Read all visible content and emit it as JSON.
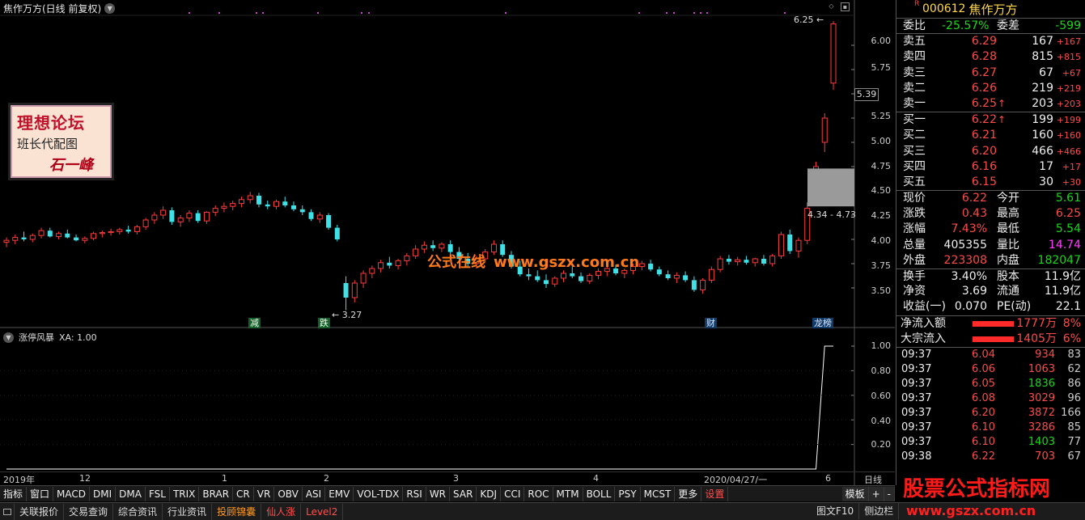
{
  "chart": {
    "title": "焦作万方(日线 前复权)",
    "high_label": "6.25",
    "low_label": "3.27",
    "range_label": "4.34 - 4.73",
    "current_price_box": "5.39",
    "price_ticks": [
      "6.00",
      "5.75",
      "5.50",
      "5.25",
      "5.00",
      "4.75",
      "4.50",
      "4.25",
      "4.00",
      "3.75",
      "3.50"
    ],
    "events": [
      {
        "label": "减",
        "style": "green"
      },
      {
        "label": "跌",
        "style": "green"
      },
      {
        "label": "财",
        "style": "blue"
      },
      {
        "label": "龙榜",
        "style": "blue"
      }
    ],
    "watermark_box": {
      "line1": "理想论坛",
      "line2": "班长代配图",
      "line3": "石一峰"
    },
    "site_watermark": {
      "text": "公式在线",
      "url": "www.gszx.com.cn"
    }
  },
  "indicator": {
    "name": "涨停风暴",
    "param": "XA: 1.00",
    "ticks": [
      "1.00",
      "0.80",
      "0.60",
      "0.40",
      "0.20"
    ]
  },
  "date_axis": [
    "2019年",
    "12",
    "1",
    "2",
    "3",
    "4",
    "2020/04/27/一",
    "6",
    "日线"
  ],
  "indicator_tabs": [
    "指标",
    "窗口",
    "MACD",
    "DMI",
    "DMA",
    "FSL",
    "TRIX",
    "BRAR",
    "CR",
    "VR",
    "OBV",
    "ASI",
    "EMV",
    "VOL-TDX",
    "RSI",
    "WR",
    "SAR",
    "KDJ",
    "CCI",
    "ROC",
    "MTM",
    "BOLL",
    "PSY",
    "MCST",
    "更多",
    "设置"
  ],
  "tab_right": [
    "模板",
    "+",
    "-"
  ],
  "status_buttons": [
    {
      "label": "关联报价",
      "style": "normal"
    },
    {
      "label": "交易查询",
      "style": "normal"
    },
    {
      "label": "综合资讯",
      "style": "normal"
    },
    {
      "label": "行业资讯",
      "style": "normal"
    },
    {
      "label": "投顾锦囊",
      "style": "orange"
    },
    {
      "label": "仙人涨",
      "style": "red"
    },
    {
      "label": "Level2",
      "style": "red"
    }
  ],
  "status_right": [
    "图文F10",
    "侧边栏"
  ],
  "quote": {
    "badge": "R",
    "code": "000612",
    "name": "焦作万方",
    "weibi_label": "委比",
    "weibi": "-25.57%",
    "weicha_label": "委差",
    "weicha": "-599",
    "sell": [
      {
        "label": "卖五",
        "price": "6.29",
        "vol": "167",
        "chg": "+167",
        "arrow": ""
      },
      {
        "label": "卖四",
        "price": "6.28",
        "vol": "815",
        "chg": "+815",
        "arrow": ""
      },
      {
        "label": "卖三",
        "price": "6.27",
        "vol": "67",
        "chg": "+67",
        "arrow": ""
      },
      {
        "label": "卖二",
        "price": "6.26",
        "vol": "219",
        "chg": "+219",
        "arrow": ""
      },
      {
        "label": "卖一",
        "price": "6.25",
        "vol": "203",
        "chg": "+203",
        "arrow": "↑"
      }
    ],
    "buy": [
      {
        "label": "买一",
        "price": "6.22",
        "vol": "199",
        "chg": "+199",
        "arrow": "↑"
      },
      {
        "label": "买二",
        "price": "6.21",
        "vol": "160",
        "chg": "+160",
        "arrow": ""
      },
      {
        "label": "买三",
        "price": "6.20",
        "vol": "466",
        "chg": "+466",
        "arrow": ""
      },
      {
        "label": "买四",
        "price": "6.16",
        "vol": "17",
        "chg": "+17",
        "arrow": ""
      },
      {
        "label": "买五",
        "price": "6.15",
        "vol": "30",
        "chg": "+30",
        "arrow": ""
      }
    ],
    "stats": [
      {
        "l1": "现价",
        "v1": "6.22",
        "c1": "red",
        "l2": "今开",
        "v2": "5.61",
        "c2": "green"
      },
      {
        "l1": "涨跌",
        "v1": "0.43",
        "c1": "red",
        "l2": "最高",
        "v2": "6.25",
        "c2": "red"
      },
      {
        "l1": "涨幅",
        "v1": "7.43%",
        "c1": "red",
        "l2": "最低",
        "v2": "5.54",
        "c2": "green"
      },
      {
        "l1": "总量",
        "v1": "405355",
        "c1": "white",
        "l2": "量比",
        "v2": "14.74",
        "c2": "magenta"
      },
      {
        "l1": "外盘",
        "v1": "223308",
        "c1": "red",
        "l2": "内盘",
        "v2": "182047",
        "c2": "green"
      },
      {
        "l1": "换手",
        "v1": "3.40%",
        "c1": "white",
        "l2": "股本",
        "v2": "11.9亿",
        "c2": "white"
      },
      {
        "l1": "净资",
        "v1": "3.69",
        "c1": "white",
        "l2": "流通",
        "v2": "11.9亿",
        "c2": "white"
      },
      {
        "l1": "收益(一)",
        "v1": "0.070",
        "c1": "white",
        "l2": "PE(动)",
        "v2": "22.1",
        "c2": "white"
      }
    ],
    "flows": [
      {
        "label": "净流入额",
        "value": "1777万",
        "pct": "8%",
        "bar_pct": 0.85
      },
      {
        "label": "大宗流入",
        "value": "1405万",
        "pct": "6%",
        "bar_pct": 0.85
      }
    ],
    "ticks": [
      {
        "time": "09:37",
        "price": "6.04",
        "vol": "934",
        "vcolor": "red",
        "cnt": "83"
      },
      {
        "time": "09:37",
        "price": "6.06",
        "vol": "1063",
        "vcolor": "red",
        "cnt": "62"
      },
      {
        "time": "09:37",
        "price": "6.05",
        "vol": "1836",
        "vcolor": "green",
        "cnt": "86"
      },
      {
        "time": "09:37",
        "price": "6.08",
        "vol": "3029",
        "vcolor": "red",
        "cnt": "96"
      },
      {
        "time": "09:37",
        "price": "6.20",
        "vol": "3872",
        "vcolor": "red",
        "cnt": "166"
      },
      {
        "time": "09:37",
        "price": "6.10",
        "vol": "3286",
        "vcolor": "red",
        "cnt": "85"
      },
      {
        "time": "09:37",
        "price": "6.10",
        "vol": "1403",
        "vcolor": "green",
        "cnt": "77"
      },
      {
        "time": "09:38",
        "price": "6.22",
        "vol": "703",
        "vcolor": "red",
        "cnt": "67"
      }
    ],
    "footer_text": "股票公式指标网",
    "footer_url": "www.gszx.com.cn"
  },
  "chart_data": {
    "type": "candlestick",
    "ylim": [
      3.3,
      6.3
    ],
    "indicator_series": {
      "name": "XA",
      "ylim": [
        0,
        1.05
      ]
    },
    "ohlc": [
      [
        3.97,
        4.02,
        3.92,
        3.99
      ],
      [
        3.99,
        4.05,
        3.95,
        4.02
      ],
      [
        4.02,
        4.08,
        3.98,
        4.0
      ],
      [
        4.0,
        4.06,
        3.97,
        4.04
      ],
      [
        4.04,
        4.12,
        4.01,
        4.09
      ],
      [
        4.09,
        4.12,
        4.02,
        4.03
      ],
      [
        4.03,
        4.08,
        4.0,
        4.06
      ],
      [
        4.06,
        4.1,
        4.01,
        4.02
      ],
      [
        4.02,
        4.05,
        3.98,
        3.99
      ],
      [
        3.99,
        4.03,
        3.96,
        4.01
      ],
      [
        4.01,
        4.08,
        3.99,
        4.06
      ],
      [
        4.06,
        4.09,
        4.02,
        4.07
      ],
      [
        4.07,
        4.11,
        4.04,
        4.08
      ],
      [
        4.08,
        4.12,
        4.05,
        4.1
      ],
      [
        4.1,
        4.14,
        4.06,
        4.08
      ],
      [
        4.08,
        4.15,
        4.05,
        4.13
      ],
      [
        4.13,
        4.22,
        4.1,
        4.2
      ],
      [
        4.2,
        4.28,
        4.16,
        4.25
      ],
      [
        4.25,
        4.34,
        4.21,
        4.3
      ],
      [
        4.3,
        4.33,
        4.15,
        4.18
      ],
      [
        4.18,
        4.25,
        4.13,
        4.22
      ],
      [
        4.22,
        4.3,
        4.18,
        4.27
      ],
      [
        4.27,
        4.3,
        4.17,
        4.19
      ],
      [
        4.19,
        4.29,
        4.16,
        4.28
      ],
      [
        4.28,
        4.35,
        4.24,
        4.32
      ],
      [
        4.32,
        4.38,
        4.28,
        4.34
      ],
      [
        4.34,
        4.4,
        4.3,
        4.37
      ],
      [
        4.37,
        4.44,
        4.33,
        4.41
      ],
      [
        4.41,
        4.49,
        4.37,
        4.45
      ],
      [
        4.45,
        4.48,
        4.33,
        4.36
      ],
      [
        4.36,
        4.4,
        4.31,
        4.34
      ],
      [
        4.34,
        4.41,
        4.31,
        4.39
      ],
      [
        4.39,
        4.44,
        4.33,
        4.35
      ],
      [
        4.35,
        4.39,
        4.29,
        4.31
      ],
      [
        4.31,
        4.35,
        4.25,
        4.28
      ],
      [
        4.28,
        4.31,
        4.19,
        4.21
      ],
      [
        4.21,
        4.28,
        4.17,
        4.25
      ],
      [
        4.25,
        4.27,
        4.1,
        4.12
      ],
      [
        4.12,
        4.15,
        3.98,
        4.0
      ],
      [
        3.55,
        3.62,
        3.27,
        3.4
      ],
      [
        3.4,
        3.58,
        3.35,
        3.55
      ],
      [
        3.55,
        3.68,
        3.5,
        3.65
      ],
      [
        3.65,
        3.73,
        3.6,
        3.7
      ],
      [
        3.7,
        3.79,
        3.66,
        3.76
      ],
      [
        3.76,
        3.82,
        3.7,
        3.73
      ],
      [
        3.73,
        3.8,
        3.69,
        3.78
      ],
      [
        3.78,
        3.86,
        3.73,
        3.83
      ],
      [
        3.83,
        3.94,
        3.8,
        3.9
      ],
      [
        3.9,
        3.98,
        3.86,
        3.94
      ],
      [
        3.94,
        3.99,
        3.88,
        3.91
      ],
      [
        3.91,
        3.97,
        3.87,
        3.95
      ],
      [
        3.95,
        3.99,
        3.85,
        3.87
      ],
      [
        3.87,
        3.92,
        3.78,
        3.8
      ],
      [
        3.8,
        3.86,
        3.72,
        3.75
      ],
      [
        3.75,
        3.83,
        3.7,
        3.8
      ],
      [
        3.8,
        3.9,
        3.76,
        3.87
      ],
      [
        3.87,
        3.99,
        3.84,
        3.95
      ],
      [
        3.95,
        3.99,
        3.82,
        3.84
      ],
      [
        3.84,
        3.88,
        3.7,
        3.72
      ],
      [
        3.72,
        3.78,
        3.62,
        3.64
      ],
      [
        3.64,
        3.7,
        3.58,
        3.62
      ],
      [
        3.62,
        3.68,
        3.56,
        3.58
      ],
      [
        3.58,
        3.64,
        3.5,
        3.54
      ],
      [
        3.54,
        3.62,
        3.51,
        3.6
      ],
      [
        3.6,
        3.68,
        3.56,
        3.65
      ],
      [
        3.65,
        3.72,
        3.6,
        3.62
      ],
      [
        3.62,
        3.66,
        3.55,
        3.57
      ],
      [
        3.57,
        3.65,
        3.54,
        3.63
      ],
      [
        3.63,
        3.7,
        3.59,
        3.67
      ],
      [
        3.67,
        3.72,
        3.62,
        3.7
      ],
      [
        3.7,
        3.74,
        3.63,
        3.65
      ],
      [
        3.65,
        3.7,
        3.6,
        3.68
      ],
      [
        3.68,
        3.75,
        3.64,
        3.72
      ],
      [
        3.72,
        3.78,
        3.68,
        3.75
      ],
      [
        3.75,
        3.79,
        3.67,
        3.69
      ],
      [
        3.69,
        3.72,
        3.62,
        3.64
      ],
      [
        3.64,
        3.68,
        3.58,
        3.6
      ],
      [
        3.6,
        3.66,
        3.55,
        3.63
      ],
      [
        3.63,
        3.67,
        3.56,
        3.58
      ],
      [
        3.58,
        3.62,
        3.46,
        3.48
      ],
      [
        3.48,
        3.6,
        3.44,
        3.58
      ],
      [
        3.58,
        3.72,
        3.55,
        3.69
      ],
      [
        3.69,
        3.83,
        3.66,
        3.8
      ],
      [
        3.8,
        3.84,
        3.74,
        3.77
      ],
      [
        3.77,
        3.82,
        3.73,
        3.79
      ],
      [
        3.79,
        3.83,
        3.74,
        3.76
      ],
      [
        3.76,
        3.81,
        3.72,
        3.8
      ],
      [
        3.8,
        3.84,
        3.73,
        3.75
      ],
      [
        3.75,
        3.85,
        3.72,
        3.83
      ],
      [
        3.83,
        4.08,
        3.8,
        4.05
      ],
      [
        4.05,
        4.1,
        3.85,
        3.88
      ],
      [
        3.88,
        4.02,
        3.81,
        3.99
      ],
      [
        3.99,
        4.38,
        3.95,
        4.32
      ],
      [
        4.68,
        4.8,
        4.66,
        4.75
      ],
      [
        5.0,
        5.3,
        4.9,
        5.25
      ],
      [
        5.61,
        6.25,
        5.54,
        6.22
      ]
    ],
    "xa": [
      0,
      0,
      0,
      0,
      0,
      0,
      0,
      0,
      0,
      0,
      0,
      0,
      0,
      0,
      0,
      0,
      0,
      0,
      0,
      0,
      0,
      0,
      0,
      0,
      0,
      0,
      0,
      0,
      0,
      0,
      0,
      0,
      0,
      0,
      0,
      0,
      0,
      0,
      0,
      0,
      0,
      0,
      0,
      0,
      0,
      0,
      0,
      0,
      0,
      0,
      0,
      0,
      0,
      0,
      0,
      0,
      0,
      0,
      0,
      0,
      0,
      0,
      0,
      0,
      0,
      0,
      0,
      0,
      0,
      0,
      0,
      0,
      0,
      0,
      0,
      0,
      0,
      0,
      0,
      0,
      0,
      0,
      0,
      0,
      0,
      0,
      0,
      0,
      0,
      0,
      0,
      0,
      0,
      0,
      1,
      1
    ]
  }
}
